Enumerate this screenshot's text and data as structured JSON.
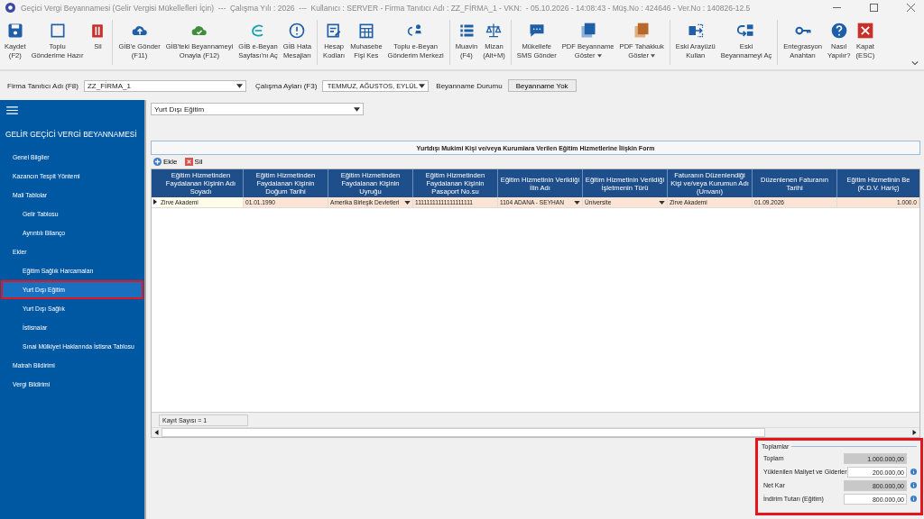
{
  "window": {
    "title": "Geçici Vergi Beyannamesi (Gelir Vergisi Mükellefleri İçin)  ---  Çalışma Yılı : 2026  ---  Kullanıcı : SERVER - Firma Tanıtıcı Adı : ZZ_FİRMA_1 - VKN:  - 05.10.2026 - 14:08:43 - Müş.No : 424646 - Ver.No : 140826-12.5"
  },
  "toolbar": [
    [
      {
        "label": "Kaydet\n(F2)",
        "kind": "save",
        "menu": false
      },
      {
        "label": "Toplu\nGönderime Hazır",
        "kind": "checkbox",
        "menu": false
      },
      {
        "label": "Sil",
        "kind": "trash",
        "menu": false
      }
    ],
    [
      {
        "label": "GİB'e Gönder\n(F11)",
        "kind": "cloud-up",
        "menu": false
      },
      {
        "label": "GİB'teki Beyannameyi\nOnayla (F12)",
        "kind": "cloud-check",
        "menu": false
      },
      {
        "label": "GİB e-Beyan\nSayfası'nı Aç",
        "kind": "swirl",
        "menu": false
      },
      {
        "label": "GİB Hata\nMesajları",
        "kind": "alert",
        "menu": false
      }
    ],
    [
      {
        "label": "Hesap\nKodları",
        "kind": "form",
        "menu": false
      },
      {
        "label": "Muhasebe\nFişi Kes",
        "kind": "grid",
        "menu": false
      },
      {
        "label": "Toplu e-Beyan\nGönderim Merkezi",
        "kind": "sync",
        "menu": false
      }
    ],
    [
      {
        "label": "Muavin\n(F4)",
        "kind": "list",
        "menu": false
      },
      {
        "label": "Mizan\n(Alt+M)",
        "kind": "scales",
        "menu": false
      }
    ],
    [
      {
        "label": "Mükellefe\nSMS Gönder",
        "kind": "chat",
        "menu": false
      },
      {
        "label": "PDF Beyanname\nGöster",
        "kind": "pdf",
        "menu": true
      },
      {
        "label": "PDF Tahakkuk\nGöster",
        "kind": "pdf-orange",
        "menu": true
      }
    ],
    [
      {
        "label": "Eski Arayüzü\nKullan",
        "kind": "exchange",
        "menu": false
      },
      {
        "label": "Eski\nBeyannameyi Aç",
        "kind": "swap",
        "menu": false
      }
    ],
    [
      {
        "label": "Entegrasyon\nAnahtarı",
        "kind": "key",
        "menu": false
      },
      {
        "label": "Nasıl\nYapılır?",
        "kind": "help",
        "menu": false
      },
      {
        "label": "Kapat\n(ESC)",
        "kind": "close",
        "menu": false
      }
    ]
  ],
  "filters": {
    "firm_label": "Firma Tanıtıcı Adı (F8)",
    "firm": "ZZ_FİRMA_1",
    "months_label": "Çalışma Ayları (F3)",
    "months": "TEMMUZ, AĞUSTOS, EYLÜL",
    "status_label": "Beyanname Durumu",
    "status": "Beyanname Yok"
  },
  "sidebar": {
    "title": "GELİR GEÇİCİ VERGİ BEYANNAMESİ",
    "items": [
      {
        "label": "Genel Bilgiler",
        "selected": false,
        "highlighted": false
      },
      {
        "label": "Kazancın Tespit Yöntemi",
        "selected": false,
        "highlighted": false
      },
      {
        "label": "Mali Tablolar",
        "selected": false,
        "highlighted": false,
        "children": [
          {
            "label": "Gelir Tablosu",
            "selected": false,
            "highlighted": false
          },
          {
            "label": "Ayrıntılı Bilanço",
            "selected": false,
            "highlighted": false
          }
        ]
      },
      {
        "label": "Ekler",
        "selected": false,
        "highlighted": false,
        "children": [
          {
            "label": "Eğitim Sağlık Harcamaları",
            "selected": false,
            "highlighted": false
          },
          {
            "label": "Yurt Dışı Eğitim",
            "selected": true,
            "highlighted": true
          },
          {
            "label": "Yurt Dışı Sağlık",
            "selected": false,
            "highlighted": false
          },
          {
            "label": "İstisnalar",
            "selected": false,
            "highlighted": false
          },
          {
            "label": "Sınai Mülkiyet Haklarında İstisna Tablosu",
            "selected": false,
            "highlighted": false
          }
        ]
      },
      {
        "label": "Matrah Bildirimi",
        "selected": false,
        "highlighted": false
      },
      {
        "label": "Vergi Bildirimi",
        "selected": false,
        "highlighted": false
      }
    ]
  },
  "section_select": "Yurt Dışı Eğitim",
  "form_title": "Yurtdışı Mukimi Kişi ve/veya Kurumlara Verilen Eğitim Hizmetlerine İlişkin Form",
  "grid_actions": [
    {
      "label": "Ekle",
      "kind": "add"
    },
    {
      "label": "Sil",
      "kind": "delete"
    }
  ],
  "table": {
    "columns": [
      "Eğitim Hizmetinden Faydalanan Kişinin Adı Soyadı",
      "Eğitim Hizmetinden Faydalanan Kişinin Doğum Tarihi",
      "Eğitim Hizmetinden Faydalanan Kişinin Uyruğu",
      "Eğitim Hizmetinden Faydalanan Kişinin Pasaport No.su",
      "Eğitim Hizmetinin Verildiği İlin Adı",
      "Eğitim Hizmetinin Verildiği İşletmenin Türü",
      "Faturanın Düzenlendiği Kişi ve/veya Kurumun Adı (Unvanı)",
      "Düzenlenen Faturanın Tarihi",
      "Eğitim Hizmetinin Be\n(K.D.V. Hariç)"
    ],
    "rows": [
      {
        "selected": true,
        "cells": [
          {
            "value": "Zirve Akademi",
            "kind": "text",
            "focused": true
          },
          {
            "value": "01.01.1990",
            "kind": "text",
            "focused": false
          },
          {
            "value": "Amerika Birleşik Devletleri",
            "kind": "combo",
            "focused": false
          },
          {
            "value": "11111111111111111111",
            "kind": "text",
            "focused": false
          },
          {
            "value": "1104 ADANA - SEYHAN",
            "kind": "combo",
            "focused": false
          },
          {
            "value": "Üniversite",
            "kind": "combo",
            "focused": false
          },
          {
            "value": "Zirve Akademi",
            "kind": "text",
            "focused": false
          },
          {
            "value": "01.09.2026",
            "kind": "text",
            "focused": false
          },
          {
            "value": "1.000.0",
            "kind": "amount",
            "focused": false
          }
        ]
      }
    ],
    "record_count": "Kayıt Sayısı = 1"
  },
  "totals": {
    "title": "Toplamlar",
    "highlighted": true,
    "fields": [
      {
        "label": "Toplam",
        "value": "1.000.000,00",
        "readonly": true,
        "info": false
      },
      {
        "label": "Yüklenilen Maliyet ve Giderler",
        "value": "200.000,00",
        "readonly": false,
        "info": true
      },
      {
        "label": "Net Kar",
        "value": "800.000,00",
        "readonly": true,
        "info": true
      },
      {
        "label": "İndirim Tutarı (Eğitim)",
        "value": "800.000,00",
        "readonly": false,
        "info": true
      }
    ]
  }
}
